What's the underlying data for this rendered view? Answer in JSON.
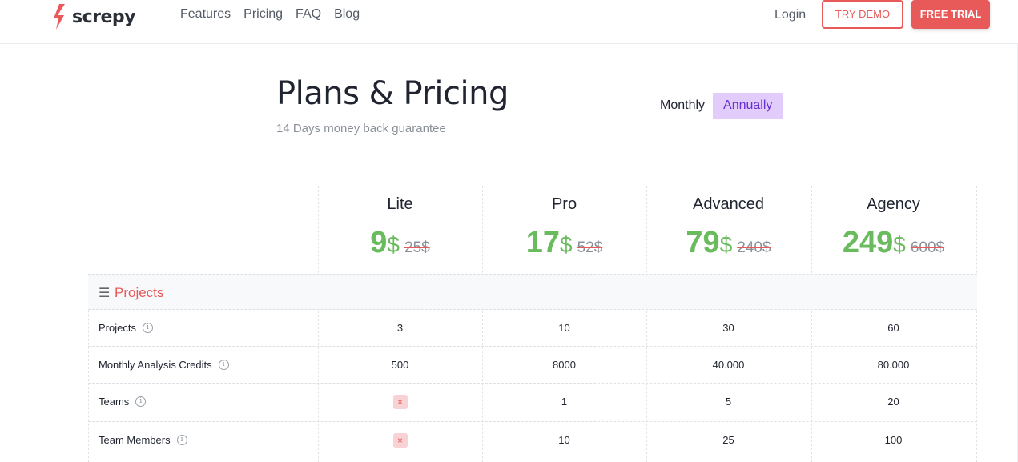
{
  "brand": {
    "name": "screpy",
    "accent": "#e85a5a"
  },
  "nav": [
    "Features",
    "Pricing",
    "FAQ",
    "Blog"
  ],
  "header": {
    "login": "Login",
    "try_demo": "TRY DEMO",
    "free_trial": "FREE TRIAL"
  },
  "page": {
    "title": "Plans & Pricing",
    "subtitle": "14 Days money back guarantee"
  },
  "billing_toggle": {
    "options": [
      "Monthly",
      "Annually"
    ],
    "selected": "Annually"
  },
  "plans": [
    {
      "name": "Lite",
      "price": "9",
      "currency": "$",
      "old_price": "25$"
    },
    {
      "name": "Pro",
      "price": "17",
      "currency": "$",
      "old_price": "52$"
    },
    {
      "name": "Advanced",
      "price": "79",
      "currency": "$",
      "old_price": "240$"
    },
    {
      "name": "Agency",
      "price": "249",
      "currency": "$",
      "old_price": "600$"
    }
  ],
  "section": {
    "icon": "menu-lines-icon",
    "label": "Projects"
  },
  "features": [
    {
      "label": "Projects",
      "values": [
        "3",
        "10",
        "30",
        "60"
      ]
    },
    {
      "label": "Monthly Analysis Credits",
      "values": [
        "500",
        "8000",
        "40.000",
        "80.000"
      ]
    },
    {
      "label": "Teams",
      "values": [
        "×",
        "1",
        "5",
        "20"
      ]
    },
    {
      "label": "Team Members",
      "values": [
        "×",
        "10",
        "25",
        "100"
      ]
    }
  ],
  "colors": {
    "price_green": "#6abb5e",
    "toggle_active_bg": "#e2ccfb",
    "toggle_active_text": "#6a2fd0",
    "not_included_bg": "#f8d2d4"
  }
}
